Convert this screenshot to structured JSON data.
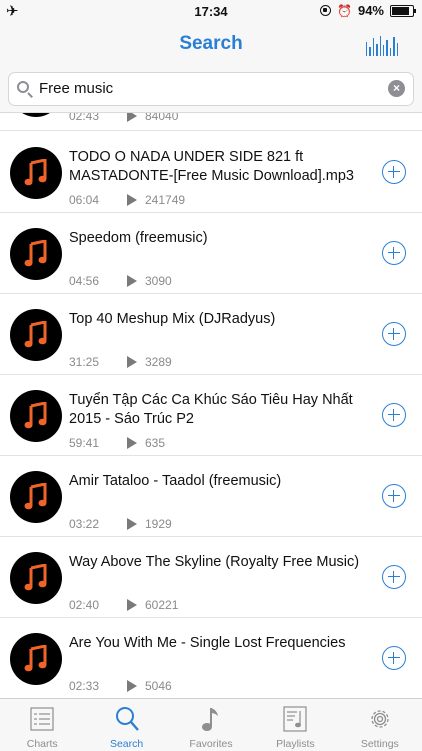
{
  "status_bar": {
    "time": "17:34",
    "battery": "94%",
    "battery_level": 0.94
  },
  "nav": {
    "title": "Search"
  },
  "search": {
    "value": "Free music"
  },
  "partial_item": {
    "duration": "02:43",
    "plays": "84040"
  },
  "items": [
    {
      "title": "TODO O NADA  UNDER SIDE 821 ft MASTADONTE-[Free Music Download].mp3",
      "duration": "06:04",
      "plays": "241749"
    },
    {
      "title": "Speedom (freemusic)",
      "duration": "04:56",
      "plays": "3090"
    },
    {
      "title": "Top 40 Meshup Mix (DJRadyus)",
      "duration": "31:25",
      "plays": "3289"
    },
    {
      "title": "Tuyển Tập Các Ca Khúc Sáo Tiêu Hay Nhất 2015 - Sáo Trúc P2",
      "duration": "59:41",
      "plays": "635"
    },
    {
      "title": "Amir Tataloo - Taadol (freemusic)",
      "duration": "03:22",
      "plays": "1929"
    },
    {
      "title": "Way Above The Skyline (Royalty Free Music)",
      "duration": "02:40",
      "plays": "60221"
    },
    {
      "title": "Are You With Me - Single Lost Frequencies",
      "duration": "02:33",
      "plays": "5046"
    }
  ],
  "tabs": [
    {
      "label": "Charts",
      "icon": "list-icon",
      "active": false
    },
    {
      "label": "Search",
      "icon": "search-icon",
      "active": true
    },
    {
      "label": "Favorites",
      "icon": "music-note-icon",
      "active": false
    },
    {
      "label": "Playlists",
      "icon": "playlist-icon",
      "active": false
    },
    {
      "label": "Settings",
      "icon": "gear-icon",
      "active": false
    }
  ],
  "colors": {
    "accent": "#2a7fd4",
    "note": "#f0642a",
    "inactive": "#8e8e93"
  }
}
